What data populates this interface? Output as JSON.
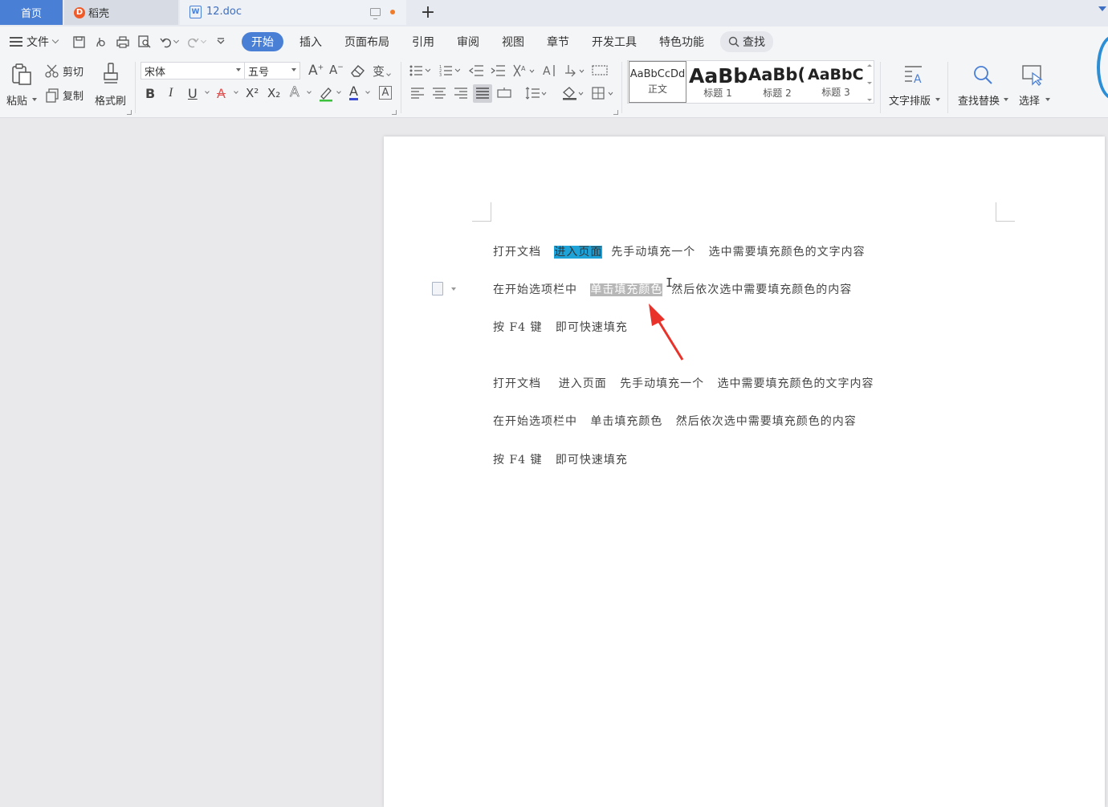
{
  "tabs": {
    "home": "首页",
    "daoke": "稻壳",
    "daoke_logo": "D",
    "doc": "12.doc",
    "doc_icon": "W",
    "add": "+"
  },
  "menu": {
    "file": "文件",
    "tabs": [
      "开始",
      "插入",
      "页面布局",
      "引用",
      "审阅",
      "视图",
      "章节",
      "开发工具",
      "特色功能"
    ],
    "search": "查找"
  },
  "ribbon": {
    "paste": "粘贴",
    "cut": "剪切",
    "copy": "复制",
    "format_painter": "格式刷",
    "font_name": "宋体",
    "font_size": "五号",
    "bold": "B",
    "italic": "I",
    "underline": "U",
    "strike": "A",
    "superscript": "X²",
    "subscript": "X₂",
    "text_effect": "A",
    "font_color": "A",
    "grow_font": "A",
    "shrink_font": "A",
    "change_case": "变",
    "char_border": "A",
    "styles": [
      {
        "sample": "AaBbCcDd",
        "name": "正文"
      },
      {
        "sample": "AaBb",
        "name": "标题 1"
      },
      {
        "sample": "AaBb(",
        "name": "标题 2"
      },
      {
        "sample": "AaBbC",
        "name": "标题 3"
      }
    ],
    "text_layout": "文字排版",
    "find_replace": "查找替换",
    "select": "选择"
  },
  "document": {
    "paragraphs": [
      {
        "before": "打开文档   ",
        "highlight": "进入页面",
        "after": "  先手动填充一个   选中需要填充颜色的文字内容",
        "highlight_color": "cyan"
      },
      {
        "before": "在开始选项栏中   ",
        "highlight": "单击填充颜色",
        "after": "  然后依次选中需要填充颜色的内容",
        "highlight_color": "gray"
      },
      {
        "before": "按 F4 键   即可快速填充",
        "highlight": "",
        "after": ""
      },
      {
        "before": "打开文档    进入页面   先手动填充一个   选中需要填充颜色的文字内容",
        "highlight": "",
        "after": ""
      },
      {
        "before": "在开始选项栏中   单击填充颜色   然后依次选中需要填充颜色的内容",
        "highlight": "",
        "after": ""
      },
      {
        "before": "按 F4 键   即可快速填充",
        "highlight": "",
        "after": ""
      }
    ],
    "text_cursor": "I"
  },
  "colors": {
    "accent": "#4a7fd6",
    "highlight_cyan": "#1ea3d9",
    "highlight_gray": "#b7b7b7",
    "arrow": "#e8322a"
  }
}
